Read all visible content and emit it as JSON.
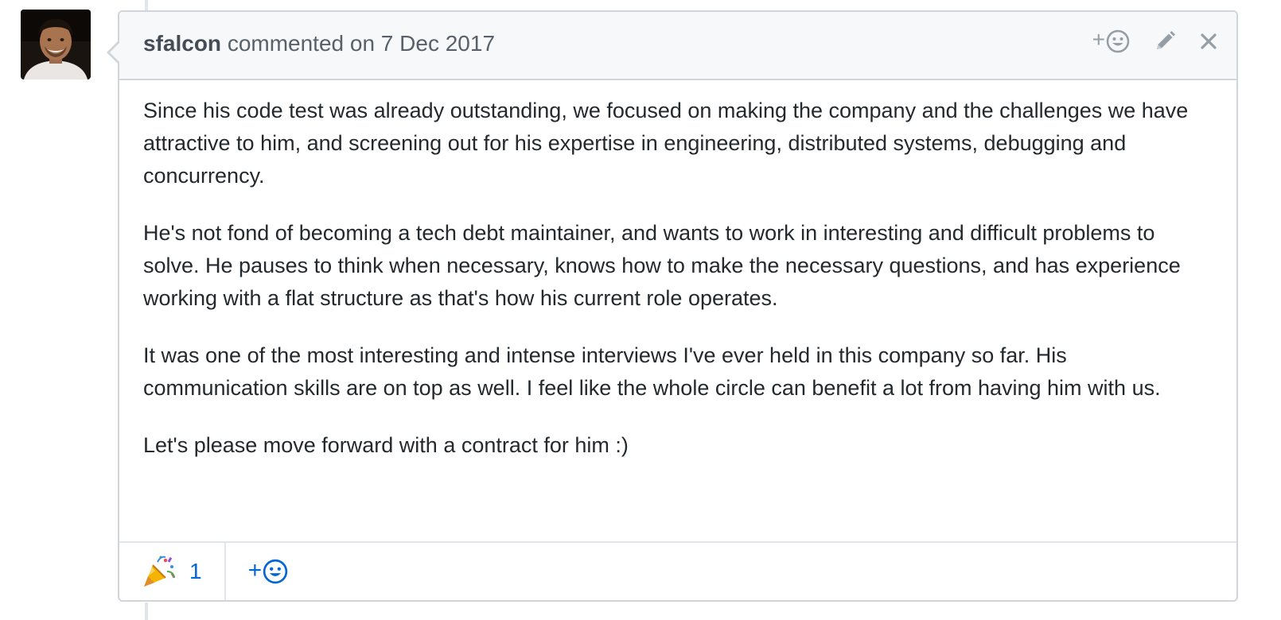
{
  "comment": {
    "author": "sfalcon",
    "action_text": "commented on 7 Dec 2017",
    "paragraphs": [
      "Since his code test was already outstanding, we focused on making the company and the challenges we have attractive to him, and screening out for his expertise in engineering, distributed systems, debugging and concurrency.",
      "He's not fond of becoming a tech debt maintainer, and wants to work in interesting and difficult problems to solve. He pauses to think when necessary, knows how to make the necessary questions, and has experience working with a flat structure as that's how his current role operates.",
      "It was one of the most interesting and intense interviews I've ever held in this company so far. His communication skills are on top as well. I feel like the whole circle can benefit a lot from having him with us.",
      "Let's please move forward with a contract for him :)"
    ]
  },
  "header_actions": {
    "add_reaction_plus": "+",
    "add_reaction_icon": "smiley-icon",
    "edit_icon": "pencil-icon",
    "delete_icon": "close-icon"
  },
  "reactions": {
    "items": [
      {
        "icon": "party-popper-icon",
        "count": "1"
      }
    ],
    "add_plus": "+",
    "add_icon": "smiley-icon"
  },
  "colors": {
    "link_blue": "#0366d6",
    "border": "#d1d5da",
    "header_bg": "#f6f8fa",
    "muted_icon": "#959da5"
  }
}
